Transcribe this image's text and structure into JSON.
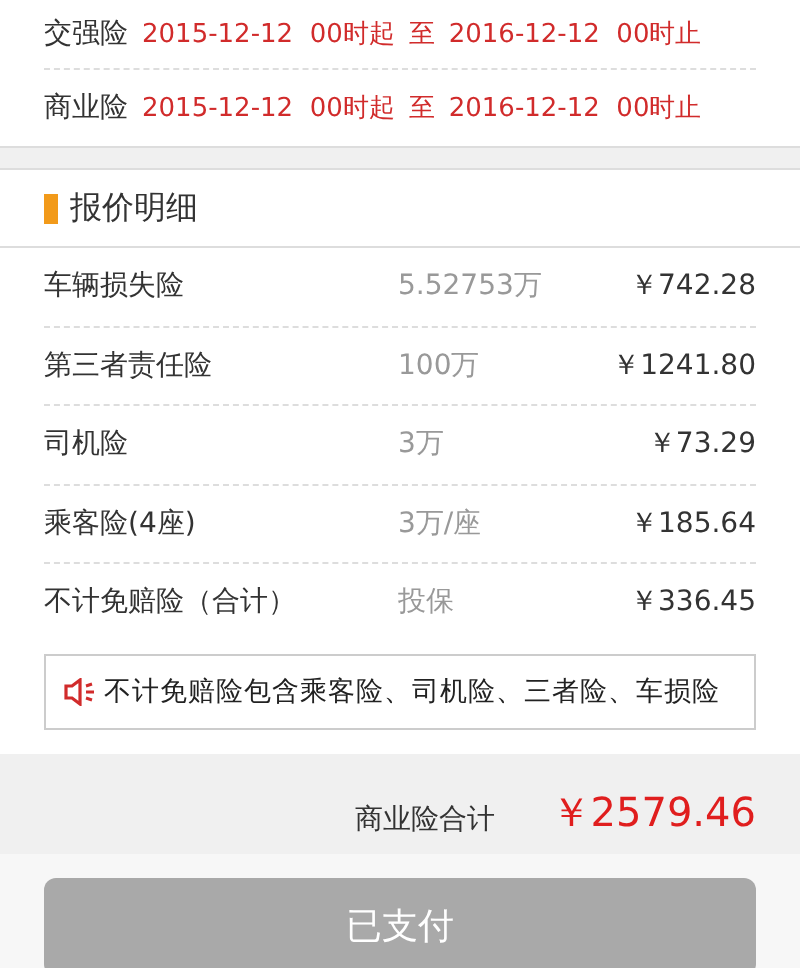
{
  "periods": [
    {
      "label": "交强险",
      "start": "2015-12-12  00时起",
      "sep": "至",
      "end": "2016-12-12  00时止"
    },
    {
      "label": "商业险",
      "start": "2015-12-12  00时起",
      "sep": "至",
      "end": "2016-12-12  00时止"
    }
  ],
  "quote": {
    "title": "报价明细",
    "rows": [
      {
        "name": "车辆损失险",
        "coverage": "5.52753万",
        "price": "￥742.28"
      },
      {
        "name": "第三者责任险",
        "coverage": "100万",
        "price": "￥1241.80"
      },
      {
        "name": "司机险",
        "coverage": "3万",
        "price": "￥73.29"
      },
      {
        "name": "乘客险(4座)",
        "coverage": "3万/座",
        "price": "￥185.64"
      },
      {
        "name": "不计免赔险（合计）",
        "coverage": "投保",
        "price": "￥336.45"
      }
    ],
    "notice": "不计免赔险包含乘客险、司机险、三者险、车损险"
  },
  "total": {
    "label": "商业险合计",
    "amount": "￥2579.46"
  },
  "pay_button": {
    "label": "已支付",
    "disabled": true
  }
}
